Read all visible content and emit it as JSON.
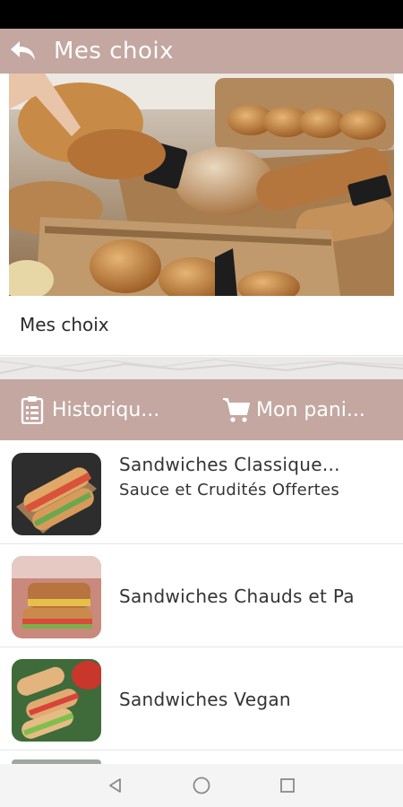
{
  "appbar": {
    "title": "Mes choix",
    "back_icon": "back-arrow-icon"
  },
  "section": {
    "title": "Mes choix"
  },
  "tabs": [
    {
      "label": "Historiqu...",
      "icon": "clipboard-icon"
    },
    {
      "label": "Mon pani...",
      "icon": "cart-icon"
    }
  ],
  "categories": [
    {
      "title": "Sandwiches Classique...",
      "subtitle": "Sauce et Crudités Offertes"
    },
    {
      "title": "Sandwiches Chauds et Pa",
      "subtitle": ""
    },
    {
      "title": "Sandwiches Vegan",
      "subtitle": ""
    }
  ],
  "colors": {
    "accent": "#c3a7a0",
    "statusbar": "#000000",
    "text": "#333333"
  }
}
